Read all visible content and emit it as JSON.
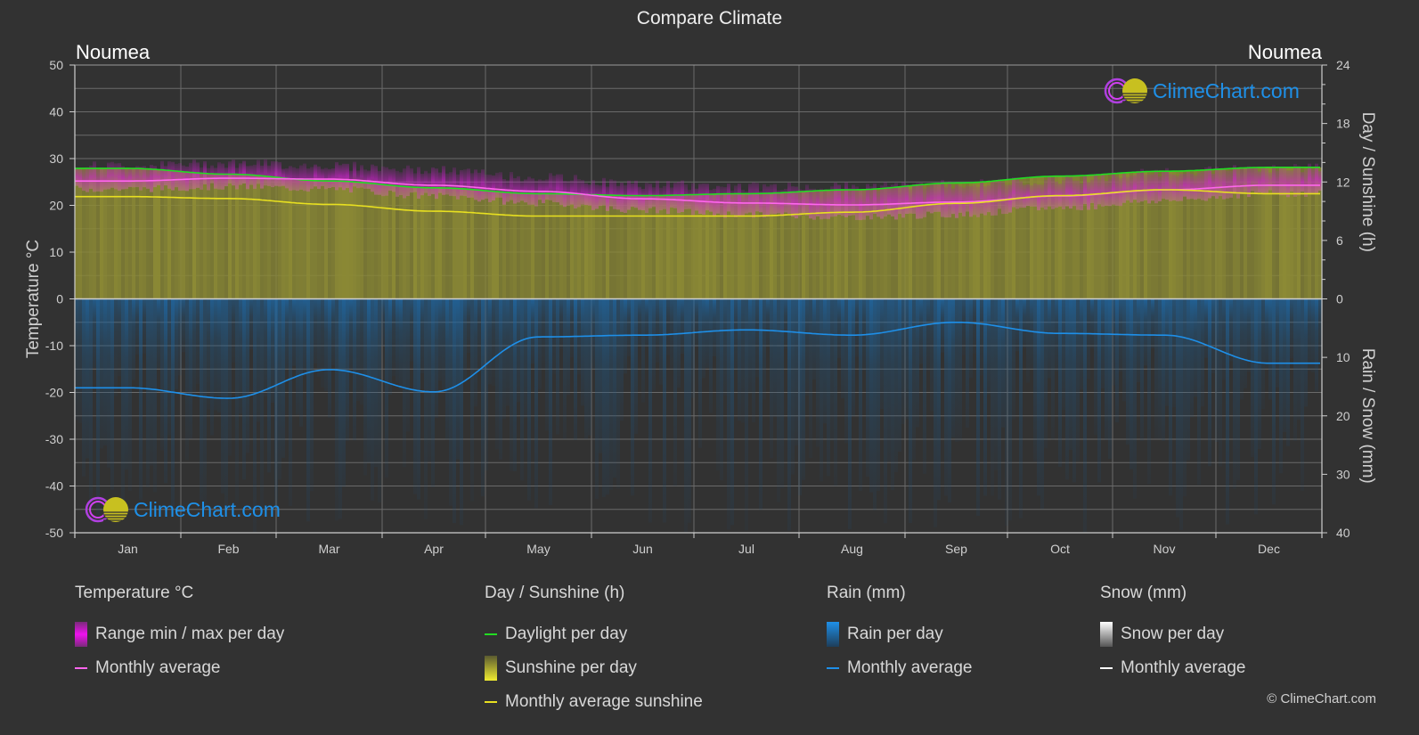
{
  "title": "Compare Climate",
  "city_left": "Noumea",
  "city_right": "Noumea",
  "watermark": "ClimeChart.com",
  "copyright": "© ClimeChart.com",
  "colors": {
    "background": "#323232",
    "daylight": "#22dd22",
    "temp_avg": "#ff66ee",
    "temp_range": "#cc22cc",
    "sunshine_fill": "#8c8a35",
    "sunshine_avg": "#e8e020",
    "rain_fill": "#1e5f96",
    "rain_avg": "#1e8fe8",
    "snow_avg": "#ffffff",
    "logo_text": "#1e90e8"
  },
  "legend": {
    "temperature": {
      "heading": "Temperature °C",
      "range": "Range min / max per day",
      "avg": "Monthly average"
    },
    "sunshine": {
      "heading": "Day / Sunshine (h)",
      "daylight": "Daylight per day",
      "sunshine": "Sunshine per day",
      "avg": "Monthly average sunshine"
    },
    "rain": {
      "heading": "Rain (mm)",
      "per_day": "Rain per day",
      "avg": "Monthly average"
    },
    "snow": {
      "heading": "Snow (mm)",
      "per_day": "Snow per day",
      "avg": "Monthly average"
    }
  },
  "chart_data": {
    "type": "line",
    "title": "Compare Climate",
    "categories": [
      "Jan",
      "Feb",
      "Mar",
      "Apr",
      "May",
      "Jun",
      "Jul",
      "Aug",
      "Sep",
      "Oct",
      "Nov",
      "Dec"
    ],
    "axes": {
      "left": {
        "label": "Temperature °C",
        "range": [
          -50,
          50
        ],
        "ticks": [
          50,
          40,
          30,
          20,
          10,
          0,
          -10,
          -20,
          -30,
          -40,
          -50
        ]
      },
      "right_top": {
        "label": "Day / Sunshine (h)",
        "range": [
          0,
          24
        ],
        "ticks": [
          24,
          18,
          12,
          6,
          0
        ]
      },
      "right_bottom": {
        "label": "Rain / Snow (mm)",
        "range": [
          0,
          40
        ],
        "ticks": [
          0,
          10,
          20,
          30,
          40
        ]
      }
    },
    "grid": true,
    "series": [
      {
        "name": "Daylight per day",
        "axis": "right_top",
        "unit": "h",
        "values": [
          13.4,
          12.8,
          12.1,
          11.4,
          10.8,
          10.6,
          10.8,
          11.2,
          11.9,
          12.6,
          13.1,
          13.5
        ]
      },
      {
        "name": "Temperature monthly average",
        "axis": "left",
        "unit": "°C",
        "values": [
          25.2,
          25.8,
          25.6,
          24.3,
          23.0,
          21.4,
          20.5,
          20.1,
          20.7,
          22.0,
          23.3,
          24.3
        ]
      },
      {
        "name": "Temperature max per day (approx)",
        "axis": "left",
        "unit": "°C",
        "values": [
          28.5,
          29.0,
          28.5,
          27.5,
          26.0,
          24.5,
          24.0,
          24.0,
          24.5,
          25.5,
          27.0,
          28.0
        ]
      },
      {
        "name": "Temperature min per day (approx)",
        "axis": "left",
        "unit": "°C",
        "values": [
          23.5,
          24.0,
          23.5,
          22.0,
          20.5,
          19.0,
          18.0,
          17.5,
          18.0,
          19.5,
          21.0,
          22.5
        ]
      },
      {
        "name": "Monthly average sunshine",
        "axis": "right_top",
        "unit": "h",
        "values": [
          10.5,
          10.3,
          9.7,
          9.0,
          8.5,
          8.5,
          8.5,
          8.9,
          9.8,
          10.6,
          11.2,
          10.8
        ]
      },
      {
        "name": "Rain monthly average",
        "axis": "right_bottom",
        "unit": "mm",
        "values": [
          15.2,
          17.0,
          12.1,
          15.9,
          6.5,
          6.2,
          5.3,
          6.2,
          4.0,
          5.9,
          6.2,
          11.0
        ]
      },
      {
        "name": "Snow monthly average",
        "axis": "right_bottom",
        "unit": "mm",
        "values": [
          0,
          0,
          0,
          0,
          0,
          0,
          0,
          0,
          0,
          0,
          0,
          0
        ]
      }
    ]
  }
}
